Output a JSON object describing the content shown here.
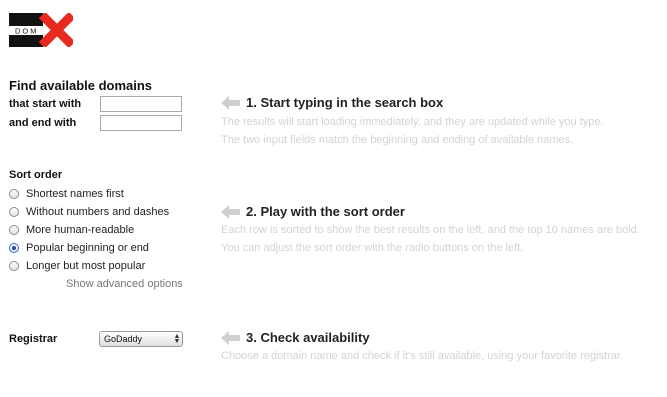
{
  "logo": {
    "text_small": "DOM",
    "text_big": "NX",
    "accent": "#e8291f"
  },
  "search": {
    "heading": "Find available domains",
    "start_label": "that start with",
    "start_value": "",
    "end_label": "and end with",
    "end_value": ""
  },
  "sort": {
    "heading": "Sort order",
    "options": [
      {
        "label": "Shortest names first",
        "checked": false
      },
      {
        "label": "Without numbers and dashes",
        "checked": false
      },
      {
        "label": "More human-readable",
        "checked": false
      },
      {
        "label": "Popular beginning or end",
        "checked": true
      },
      {
        "label": "Longer but most popular",
        "checked": false
      }
    ],
    "advanced_link": "Show advanced options"
  },
  "registrar": {
    "label": "Registrar",
    "selected": "GoDaddy"
  },
  "steps": [
    {
      "title": "1. Start typing in the search box",
      "lines": [
        "The results will start loading immediately, and they are updated while you type.",
        "The two input fields match the beginning and ending of available names."
      ]
    },
    {
      "title": "2. Play with the sort order",
      "lines": [
        "Each row is sorted to show the best results on the left, and the top 10 names are bold.",
        "You can adjust the sort order with the radio buttons on the left."
      ]
    },
    {
      "title": "3. Check availability",
      "lines": [
        "Choose a domain name and check if it's still available, using your favorite registrar."
      ]
    }
  ],
  "colors": {
    "arrow": "#cfcfcf",
    "hint_text": "#d3d3d3",
    "radio_selected": "#1d4fa8"
  },
  "icons": {
    "step_arrow": "left-arrow-icon",
    "select_arrow": "updown-arrows-icon"
  }
}
